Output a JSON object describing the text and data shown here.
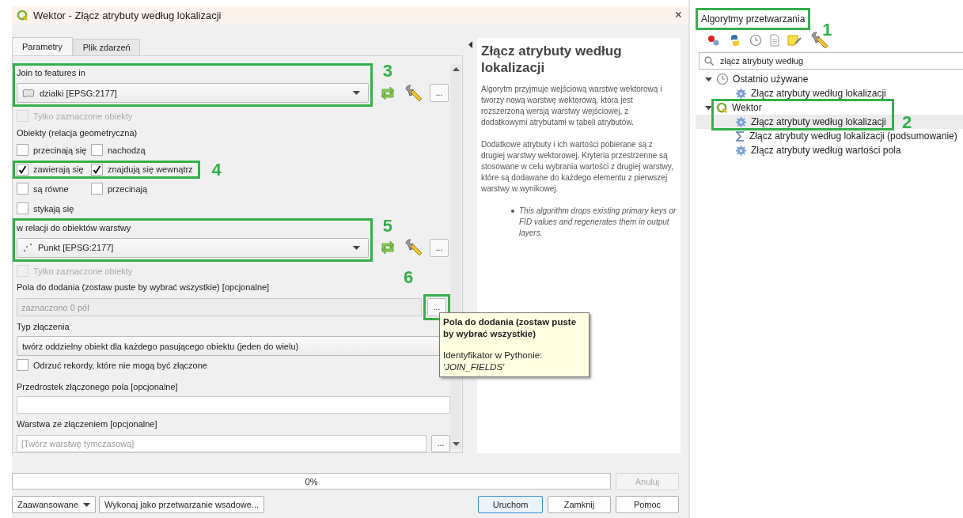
{
  "window": {
    "title": "Wektor - Złącz atrybuty według lokalizacji",
    "close": "×"
  },
  "tabs": [
    {
      "label": "Parametry",
      "selected": true
    },
    {
      "label": "Plik zdarzeń",
      "selected": false
    }
  ],
  "params": [
    {
      "kind": "layer",
      "label": "Join to features in",
      "value": "dzialki [EPSG:2177]",
      "value_icon": {
        "kind": "polygon"
      },
      "more": "...",
      "annotation": "3"
    },
    {
      "kind": "checkbox",
      "label": "Tylko zaznaczone obiekty",
      "checked": false,
      "disabled": true
    },
    {
      "kind": "label",
      "label": "Obiekty (relacja geometryczna)"
    },
    {
      "kind": "checkgrid",
      "rows": [
        {
          "items": [
            {
              "label": "przecinają się",
              "checked": false
            },
            {
              "label": "nachodzą",
              "checked": false
            }
          ]
        },
        {
          "items": [
            {
              "label": "zawierają się",
              "checked": true
            },
            {
              "label": "znajdują się wewnątrz",
              "checked": true
            }
          ],
          "annotation": "4"
        },
        {
          "items": [
            {
              "label": "są równe",
              "checked": false
            },
            {
              "label": "przecinają",
              "checked": false
            }
          ]
        },
        {
          "items": [
            {
              "label": "stykają się",
              "checked": false
            }
          ]
        }
      ]
    },
    {
      "kind": "layer",
      "label": "w relacji do obiektów warstwy",
      "value": "Punkt [EPSG:2177]",
      "value_icon": {
        "kind": "point"
      },
      "more": "...",
      "annotation": "5"
    },
    {
      "kind": "checkbox",
      "label": "Tylko zaznaczone obiekty",
      "checked": false,
      "disabled": true
    },
    {
      "kind": "fields",
      "label": "Pola do dodania (zostaw puste by wybrać wszystkie) [opcjonalne]",
      "placeholder": "zaznaczono 0 pól",
      "more": "...",
      "annotation": "6"
    },
    {
      "kind": "combo",
      "label": "Typ złączenia",
      "value": "twórz oddzielny obiekt dla każdego pasującego obiektu (jeden do wielu)"
    },
    {
      "kind": "checkbox",
      "label": "Odrzuć rekordy, które nie mogą być złączone",
      "checked": false,
      "disabled": false
    },
    {
      "kind": "text",
      "label": "Przedrostek złączonego pola [opcjonalne]"
    },
    {
      "kind": "output",
      "label": "Warstwa ze złączeniem [opcjonalne]",
      "placeholder": "[Twórz warstwę tymczasową]",
      "more": "..."
    }
  ],
  "help": {
    "title": "Złącz atrybuty według lokalizacji",
    "paragraphs": [
      "Algorytm przyjmuje wejściową warstwę wektorową i tworzy nową warstwę wektorową, która jest rozszerzoną wersją warstwy wejściowej, z dodatkowymi atrybutami w tabeli atrybutów.",
      "Dodatkowe atrybuty i ich wartości pobierane są z drugiej warstwy wektorowej. Kryteria przestrzenne są stosowane w celu wybrania wartości z drugiej warstwy, które są dodawane do każdego elementu z pierwszej warstwy w wynikowej."
    ],
    "notes": [
      "This algorithm drops existing primary keys or FID values and regenerates them in output layers."
    ]
  },
  "tooltip": {
    "title": "Pola do dodania (zostaw puste by wybrać wszystkie)",
    "identifier_label": "Identyfikator w Pythonie:",
    "identifier": "'JOIN_FIELDS'"
  },
  "progress": {
    "level": 0,
    "reading": "0%"
  },
  "cancel": {
    "label": "Anuluj",
    "disabled": true
  },
  "left_buttons": [
    {
      "label": "Zaawansowane",
      "dropdown": true
    },
    {
      "label": "Wykonaj jako przetwarzanie wsadowe...",
      "dropdown": false
    }
  ],
  "right_buttons": [
    {
      "label": "Uruchom",
      "default": true
    },
    {
      "label": "Zamknij",
      "default": false
    },
    {
      "label": "Pomoc",
      "default": false
    }
  ],
  "toolbox": {
    "title": "Algorytmy przetwarzania",
    "annotation": "1",
    "search": "złącz atrybuty według",
    "tree": [
      {
        "label": "Ostatnio używane",
        "kind": "clock",
        "expanded": true,
        "children": [
          {
            "label": "Złącz atrybuty według lokalizacji",
            "kind": "gear",
            "selected": false
          }
        ]
      },
      {
        "label": "Wektor",
        "kind": "qgis",
        "expanded": true,
        "annotation": "2",
        "children": [
          {
            "label": "Złącz atrybuty według lokalizacji",
            "kind": "gear",
            "selected": true
          },
          {
            "label": "Złącz atrybuty według lokalizacji (podsumowanie)",
            "kind": "sigma",
            "selected": false
          },
          {
            "label": "Złącz atrybuty według wartości pola",
            "kind": "gear",
            "selected": false
          }
        ]
      }
    ]
  }
}
